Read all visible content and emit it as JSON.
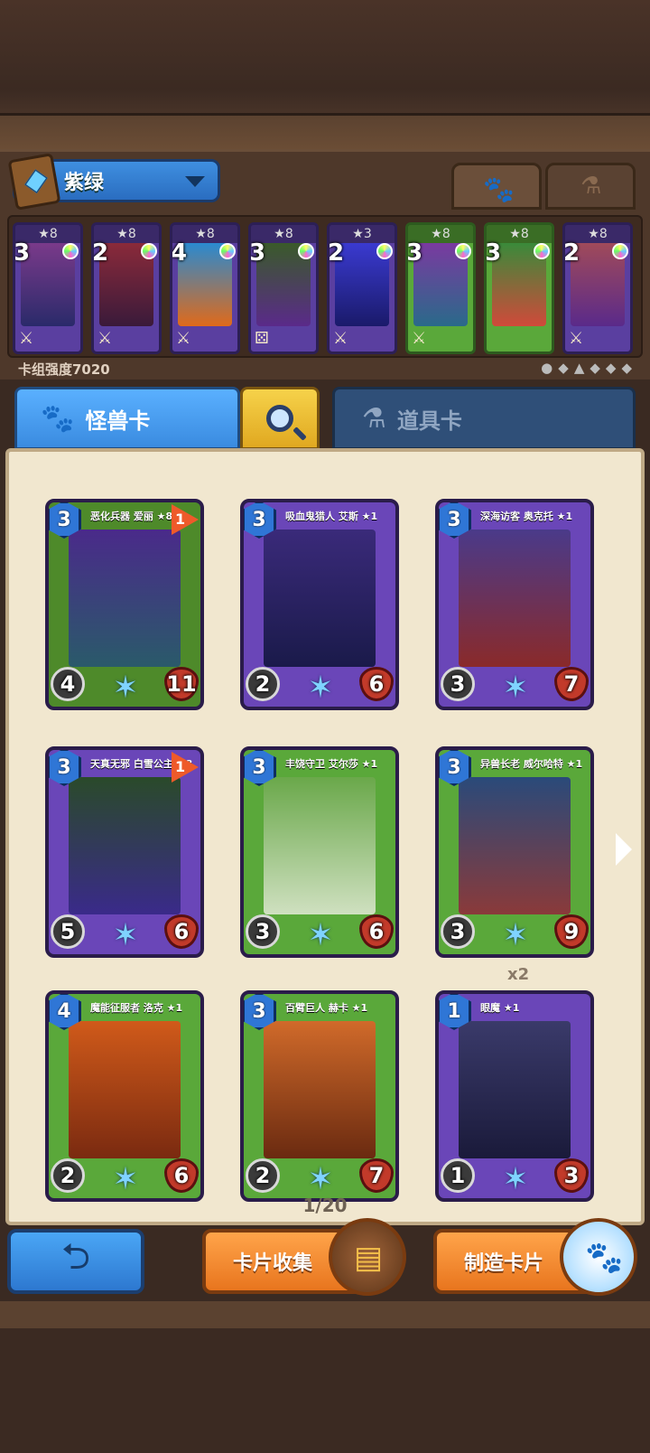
{
  "deck": {
    "name": "紫绿",
    "strength_label": "卡组强度7020",
    "filter_icons": [
      "●",
      "◆",
      "▲",
      "◆",
      "◆",
      "◆"
    ],
    "cards": [
      {
        "stars": "★8",
        "cost": "3",
        "color": "purple"
      },
      {
        "stars": "★8",
        "cost": "2",
        "color": "purple"
      },
      {
        "stars": "★8",
        "cost": "4",
        "color": "purple"
      },
      {
        "stars": "★8",
        "cost": "3",
        "color": "purple"
      },
      {
        "stars": "★3",
        "cost": "2",
        "color": "purple"
      },
      {
        "stars": "★8",
        "cost": "3",
        "color": "green"
      },
      {
        "stars": "★8",
        "cost": "3",
        "color": "green"
      },
      {
        "stars": "★8",
        "cost": "2",
        "color": "purple"
      }
    ]
  },
  "tabs": {
    "monster_label": "怪兽卡",
    "items_label": "道具卡"
  },
  "collection": {
    "cards": [
      {
        "name": "恶化兵器 爱丽 ★8",
        "cost": "3",
        "atk": "4",
        "hp": "11",
        "flag": "1",
        "extra": "4",
        "title_color": "#4e8a2a"
      },
      {
        "name": "吸血鬼猎人 艾斯 ★1",
        "cost": "3",
        "atk": "2",
        "hp": "6",
        "flag": "",
        "extra": "2",
        "title_color": "#6a46b8"
      },
      {
        "name": "深海访客 奥克托 ★1",
        "cost": "3",
        "atk": "3",
        "hp": "7",
        "flag": "",
        "extra": "",
        "title_color": "#6a46b8"
      },
      {
        "name": "天真无邪 白雪公主 ★8",
        "cost": "3",
        "atk": "5",
        "hp": "6",
        "flag": "1",
        "extra": "",
        "title_color": "#6a46b8"
      },
      {
        "name": "丰饶守卫 艾尔莎 ★1",
        "cost": "3",
        "atk": "3",
        "hp": "6",
        "flag": "",
        "extra": "",
        "title_color": "#5aa83a"
      },
      {
        "name": "异兽长老 威尔哈特 ★1",
        "cost": "3",
        "atk": "3",
        "hp": "9",
        "flag": "",
        "extra": "",
        "title_color": "#5aa83a"
      },
      {
        "name": "魔能征服者 洛克 ★1",
        "cost": "4",
        "atk": "2",
        "hp": "6",
        "flag": "",
        "extra": "",
        "title_color": "#5aa83a"
      },
      {
        "name": "百臂巨人 赫卡 ★1",
        "cost": "3",
        "atk": "2",
        "hp": "7",
        "flag": "",
        "extra": "2",
        "title_color": "#5aa83a"
      },
      {
        "name": "眼魔 ★1",
        "cost": "1",
        "atk": "1",
        "hp": "3",
        "flag": "",
        "extra": "",
        "title_color": "#6a46b8"
      }
    ],
    "duplicate_label": "x2",
    "page_label": "1/20"
  },
  "buttons": {
    "collect_label": "卡片收集",
    "craft_label": "制造卡片"
  }
}
